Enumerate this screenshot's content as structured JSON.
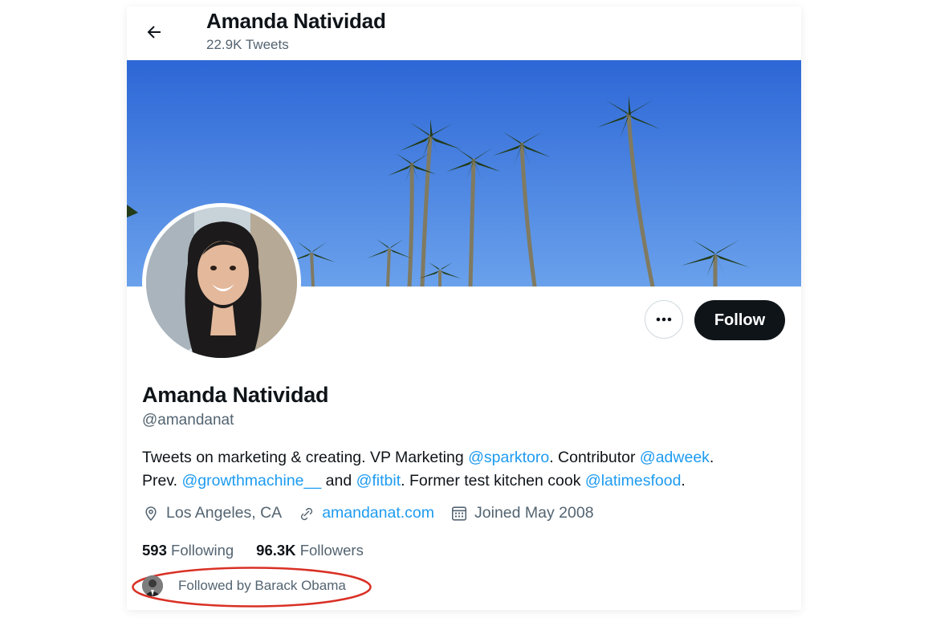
{
  "header": {
    "display_name": "Amanda Natividad",
    "tweet_count": "22.9K Tweets"
  },
  "profile": {
    "display_name": "Amanda Natividad",
    "handle": "@amandanat",
    "bio": {
      "t1": "Tweets on marketing & creating. VP Marketing ",
      "m1": "@sparktoro",
      "t2": ". Contributor ",
      "m2": "@adweek",
      "t3": ".",
      "t4": "Prev. ",
      "m3": "@growthmachine__",
      "t5": " and ",
      "m4": "@fitbit",
      "t6": ". Former test kitchen cook ",
      "m5": "@latimesfood",
      "t7": "."
    },
    "location": "Los Angeles, CA",
    "website": "amandanat.com",
    "joined": "Joined May 2008",
    "following_count": "593",
    "following_label": "Following",
    "followers_count": "96.3K",
    "followers_label": "Followers",
    "followed_by": "Followed by Barack Obama"
  },
  "actions": {
    "more": "···",
    "follow_label": "Follow"
  },
  "colors": {
    "accent": "#1d9bf0",
    "follow_button": "#0f1419",
    "highlight": "#d93025"
  },
  "icons": [
    "back-arrow-icon",
    "more-dots-icon",
    "location-pin-icon",
    "link-icon",
    "calendar-icon"
  ]
}
